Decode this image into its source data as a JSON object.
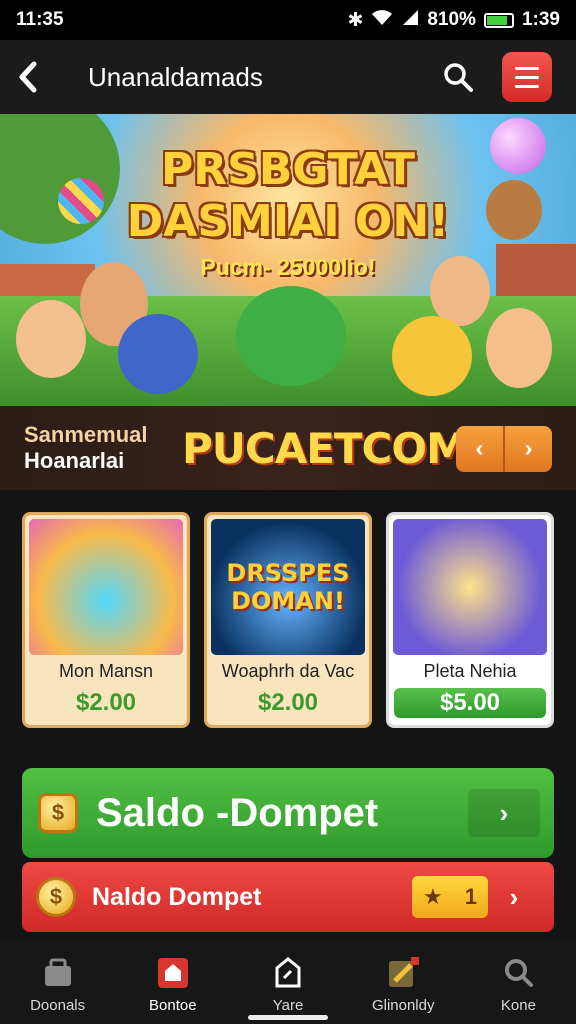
{
  "status": {
    "time_left": "11:35",
    "battery": "810%",
    "time_right": "1:39"
  },
  "header": {
    "title": "Unanaldamads",
    "icons": {
      "back": "chevron-left-icon",
      "search": "search-icon",
      "menu": "menu-icon"
    }
  },
  "hero": {
    "line1": "PRSBGTAT",
    "line2": "DASMIAI ON!",
    "subline": "Pucm- 25000lio!"
  },
  "promo": {
    "label1": "Sanmemual",
    "label2": "Hoanarlai",
    "big": "PUCAETCOM",
    "prev": "‹",
    "next": "›"
  },
  "cards": [
    {
      "art_text": "",
      "name": "Mon Mansn",
      "price": "$2.00"
    },
    {
      "art_text_1": "DRSSPES",
      "art_text_2": "DOMAN!",
      "name": "Woaphrh da Vac",
      "price": "$2.00"
    },
    {
      "art_text": "",
      "name": "Pleta Nehia",
      "price": "$5.00"
    }
  ],
  "buttons": {
    "green_label": "Saldo -Dompet",
    "green_arrow": "›",
    "red_label": "Naldo Dompet",
    "red_star_count": "1",
    "red_arrow": "›"
  },
  "nav": [
    {
      "label": "Doonals",
      "icon": "bag-icon"
    },
    {
      "label": "Bontoe",
      "icon": "home-icon"
    },
    {
      "label": "Yare",
      "icon": "note-icon"
    },
    {
      "label": "Glinonldy",
      "icon": "pencil-icon"
    },
    {
      "label": "Kone",
      "icon": "person-icon"
    }
  ],
  "colors": {
    "accent_green": "#3fae3a",
    "accent_red": "#d83430",
    "gold": "#ffd23a"
  }
}
